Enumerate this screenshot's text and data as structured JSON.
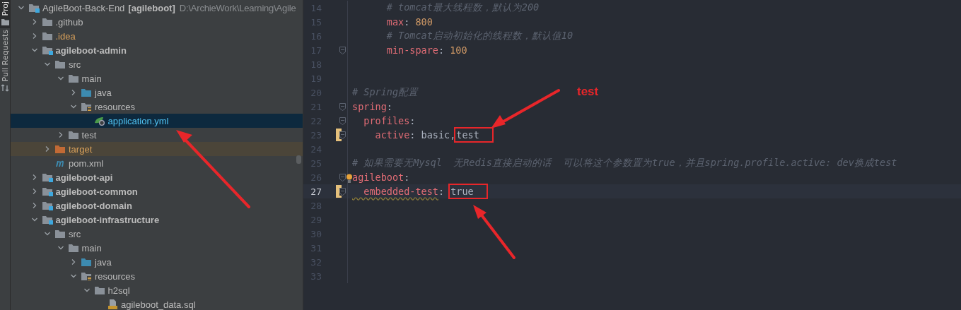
{
  "tool_strip": [
    {
      "label": "Proj",
      "selected": true
    },
    {
      "label": "Pull Requests",
      "selected": false
    }
  ],
  "tree": {
    "label": "AgileBoot-Back-End",
    "tag": "[agileboot]",
    "path": "D:\\ArchieWork\\Learning\\Agile",
    "kind": "project",
    "expanded": true,
    "selected": false,
    "children": [
      {
        "label": ".github",
        "kind": "folder",
        "expanded": false,
        "selected": false
      },
      {
        "label": ".idea",
        "kind": "ignored",
        "expanded": false,
        "selected": false
      },
      {
        "label": "agileboot-admin",
        "kind": "module",
        "expanded": true,
        "selected": false,
        "children": [
          {
            "label": "src",
            "kind": "folder",
            "expanded": true,
            "selected": false,
            "children": [
              {
                "label": "main",
                "kind": "folder",
                "expanded": true,
                "selected": false,
                "children": [
                  {
                    "label": "java",
                    "kind": "source",
                    "expanded": false,
                    "selected": false
                  },
                  {
                    "label": "resources",
                    "kind": "resources",
                    "expanded": true,
                    "selected": false,
                    "children": [
                      {
                        "label": "application.yml",
                        "kind": "yaml",
                        "selected": true
                      }
                    ]
                  }
                ]
              },
              {
                "label": "test",
                "kind": "folder",
                "expanded": false,
                "selected": false
              }
            ]
          },
          {
            "label": "target",
            "kind": "excluded",
            "expanded": false,
            "selected": false
          },
          {
            "label": "pom.xml",
            "kind": "maven",
            "selected": false
          }
        ]
      },
      {
        "label": "agileboot-api",
        "kind": "module",
        "expanded": false,
        "selected": false
      },
      {
        "label": "agileboot-common",
        "kind": "module",
        "expanded": false,
        "selected": false
      },
      {
        "label": "agileboot-domain",
        "kind": "module",
        "expanded": false,
        "selected": false
      },
      {
        "label": "agileboot-infrastructure",
        "kind": "module",
        "expanded": true,
        "selected": false,
        "children": [
          {
            "label": "src",
            "kind": "folder",
            "expanded": true,
            "selected": false,
            "children": [
              {
                "label": "main",
                "kind": "folder",
                "expanded": true,
                "selected": false,
                "children": [
                  {
                    "label": "java",
                    "kind": "source",
                    "expanded": false,
                    "selected": false
                  },
                  {
                    "label": "resources",
                    "kind": "resources",
                    "expanded": true,
                    "selected": false,
                    "children": [
                      {
                        "label": "h2sql",
                        "kind": "folder",
                        "expanded": true,
                        "selected": false,
                        "children": [
                          {
                            "label": "agileboot_data.sql",
                            "kind": "sql",
                            "selected": false
                          }
                        ]
                      }
                    ]
                  }
                ]
              }
            ]
          }
        ]
      }
    ]
  },
  "editor": {
    "lines": [
      {
        "number": "14",
        "fold": false,
        "changed": false,
        "current": false,
        "segments": [
          {
            "kind": "comment",
            "text": "      # tomcat最大线程数，默认为200"
          }
        ]
      },
      {
        "number": "15",
        "fold": false,
        "changed": false,
        "current": false,
        "segments": [
          {
            "kind": "key",
            "text": "      max"
          },
          {
            "kind": "punct",
            "text": ": "
          },
          {
            "kind": "number",
            "text": "800"
          }
        ]
      },
      {
        "number": "16",
        "fold": false,
        "changed": false,
        "current": false,
        "segments": [
          {
            "kind": "comment",
            "text": "      # Tomcat启动初始化的线程数，默认值10"
          }
        ]
      },
      {
        "number": "17",
        "fold": true,
        "changed": false,
        "current": false,
        "segments": [
          {
            "kind": "key",
            "text": "      min-spare"
          },
          {
            "kind": "punct",
            "text": ": "
          },
          {
            "kind": "number",
            "text": "100"
          }
        ]
      },
      {
        "number": "18",
        "fold": false,
        "changed": false,
        "current": false
      },
      {
        "number": "19",
        "fold": false,
        "changed": false,
        "current": false
      },
      {
        "number": "20",
        "fold": false,
        "changed": false,
        "current": false,
        "segments": [
          {
            "kind": "comment",
            "text": "# Spring配置"
          }
        ]
      },
      {
        "number": "21",
        "fold": true,
        "changed": false,
        "current": false,
        "segments": [
          {
            "kind": "key",
            "text": "spring"
          },
          {
            "kind": "punct",
            "text": ":"
          }
        ]
      },
      {
        "number": "22",
        "fold": true,
        "changed": false,
        "current": false,
        "segments": [
          {
            "kind": "key",
            "text": "  profiles"
          },
          {
            "kind": "punct",
            "text": ":"
          }
        ]
      },
      {
        "number": "23",
        "fold": true,
        "changed": true,
        "current": false,
        "segments": [
          {
            "kind": "key",
            "text": "    active"
          },
          {
            "kind": "punct",
            "text": ": "
          },
          {
            "kind": "plain",
            "text": "basic,"
          },
          {
            "kind": "plain",
            "text": "test",
            "boxed": true
          }
        ]
      },
      {
        "number": "24",
        "fold": false,
        "changed": false,
        "current": false
      },
      {
        "number": "25",
        "fold": false,
        "changed": false,
        "current": false,
        "segments": [
          {
            "kind": "comment",
            "text": "# 如果需要无Mysql  无Redis直接启动的话  可以将这个参数置为true，并且spring.profile.active: dev换成test"
          }
        ]
      },
      {
        "number": "26",
        "fold": true,
        "changed": false,
        "current": false,
        "bulb": true,
        "segments": [
          {
            "kind": "key",
            "text": "agileboot"
          },
          {
            "kind": "punct",
            "text": ":"
          }
        ]
      },
      {
        "number": "27",
        "fold": true,
        "changed": true,
        "current": true,
        "segments": [
          {
            "kind": "key",
            "text": "  embedded-test",
            "typo": true
          },
          {
            "kind": "punct",
            "text": ": "
          },
          {
            "kind": "plain",
            "text": "true",
            "boxed": true
          }
        ]
      },
      {
        "number": "28",
        "fold": false,
        "changed": false,
        "current": false
      },
      {
        "number": "29",
        "fold": false,
        "changed": false,
        "current": false
      },
      {
        "number": "30",
        "fold": false,
        "changed": false,
        "current": false
      },
      {
        "number": "31",
        "fold": false,
        "changed": false,
        "current": false
      },
      {
        "number": "32",
        "fold": false,
        "changed": false,
        "current": false
      },
      {
        "number": "33",
        "fold": false,
        "changed": false,
        "current": false
      }
    ]
  },
  "annotation": {
    "label": "test"
  }
}
